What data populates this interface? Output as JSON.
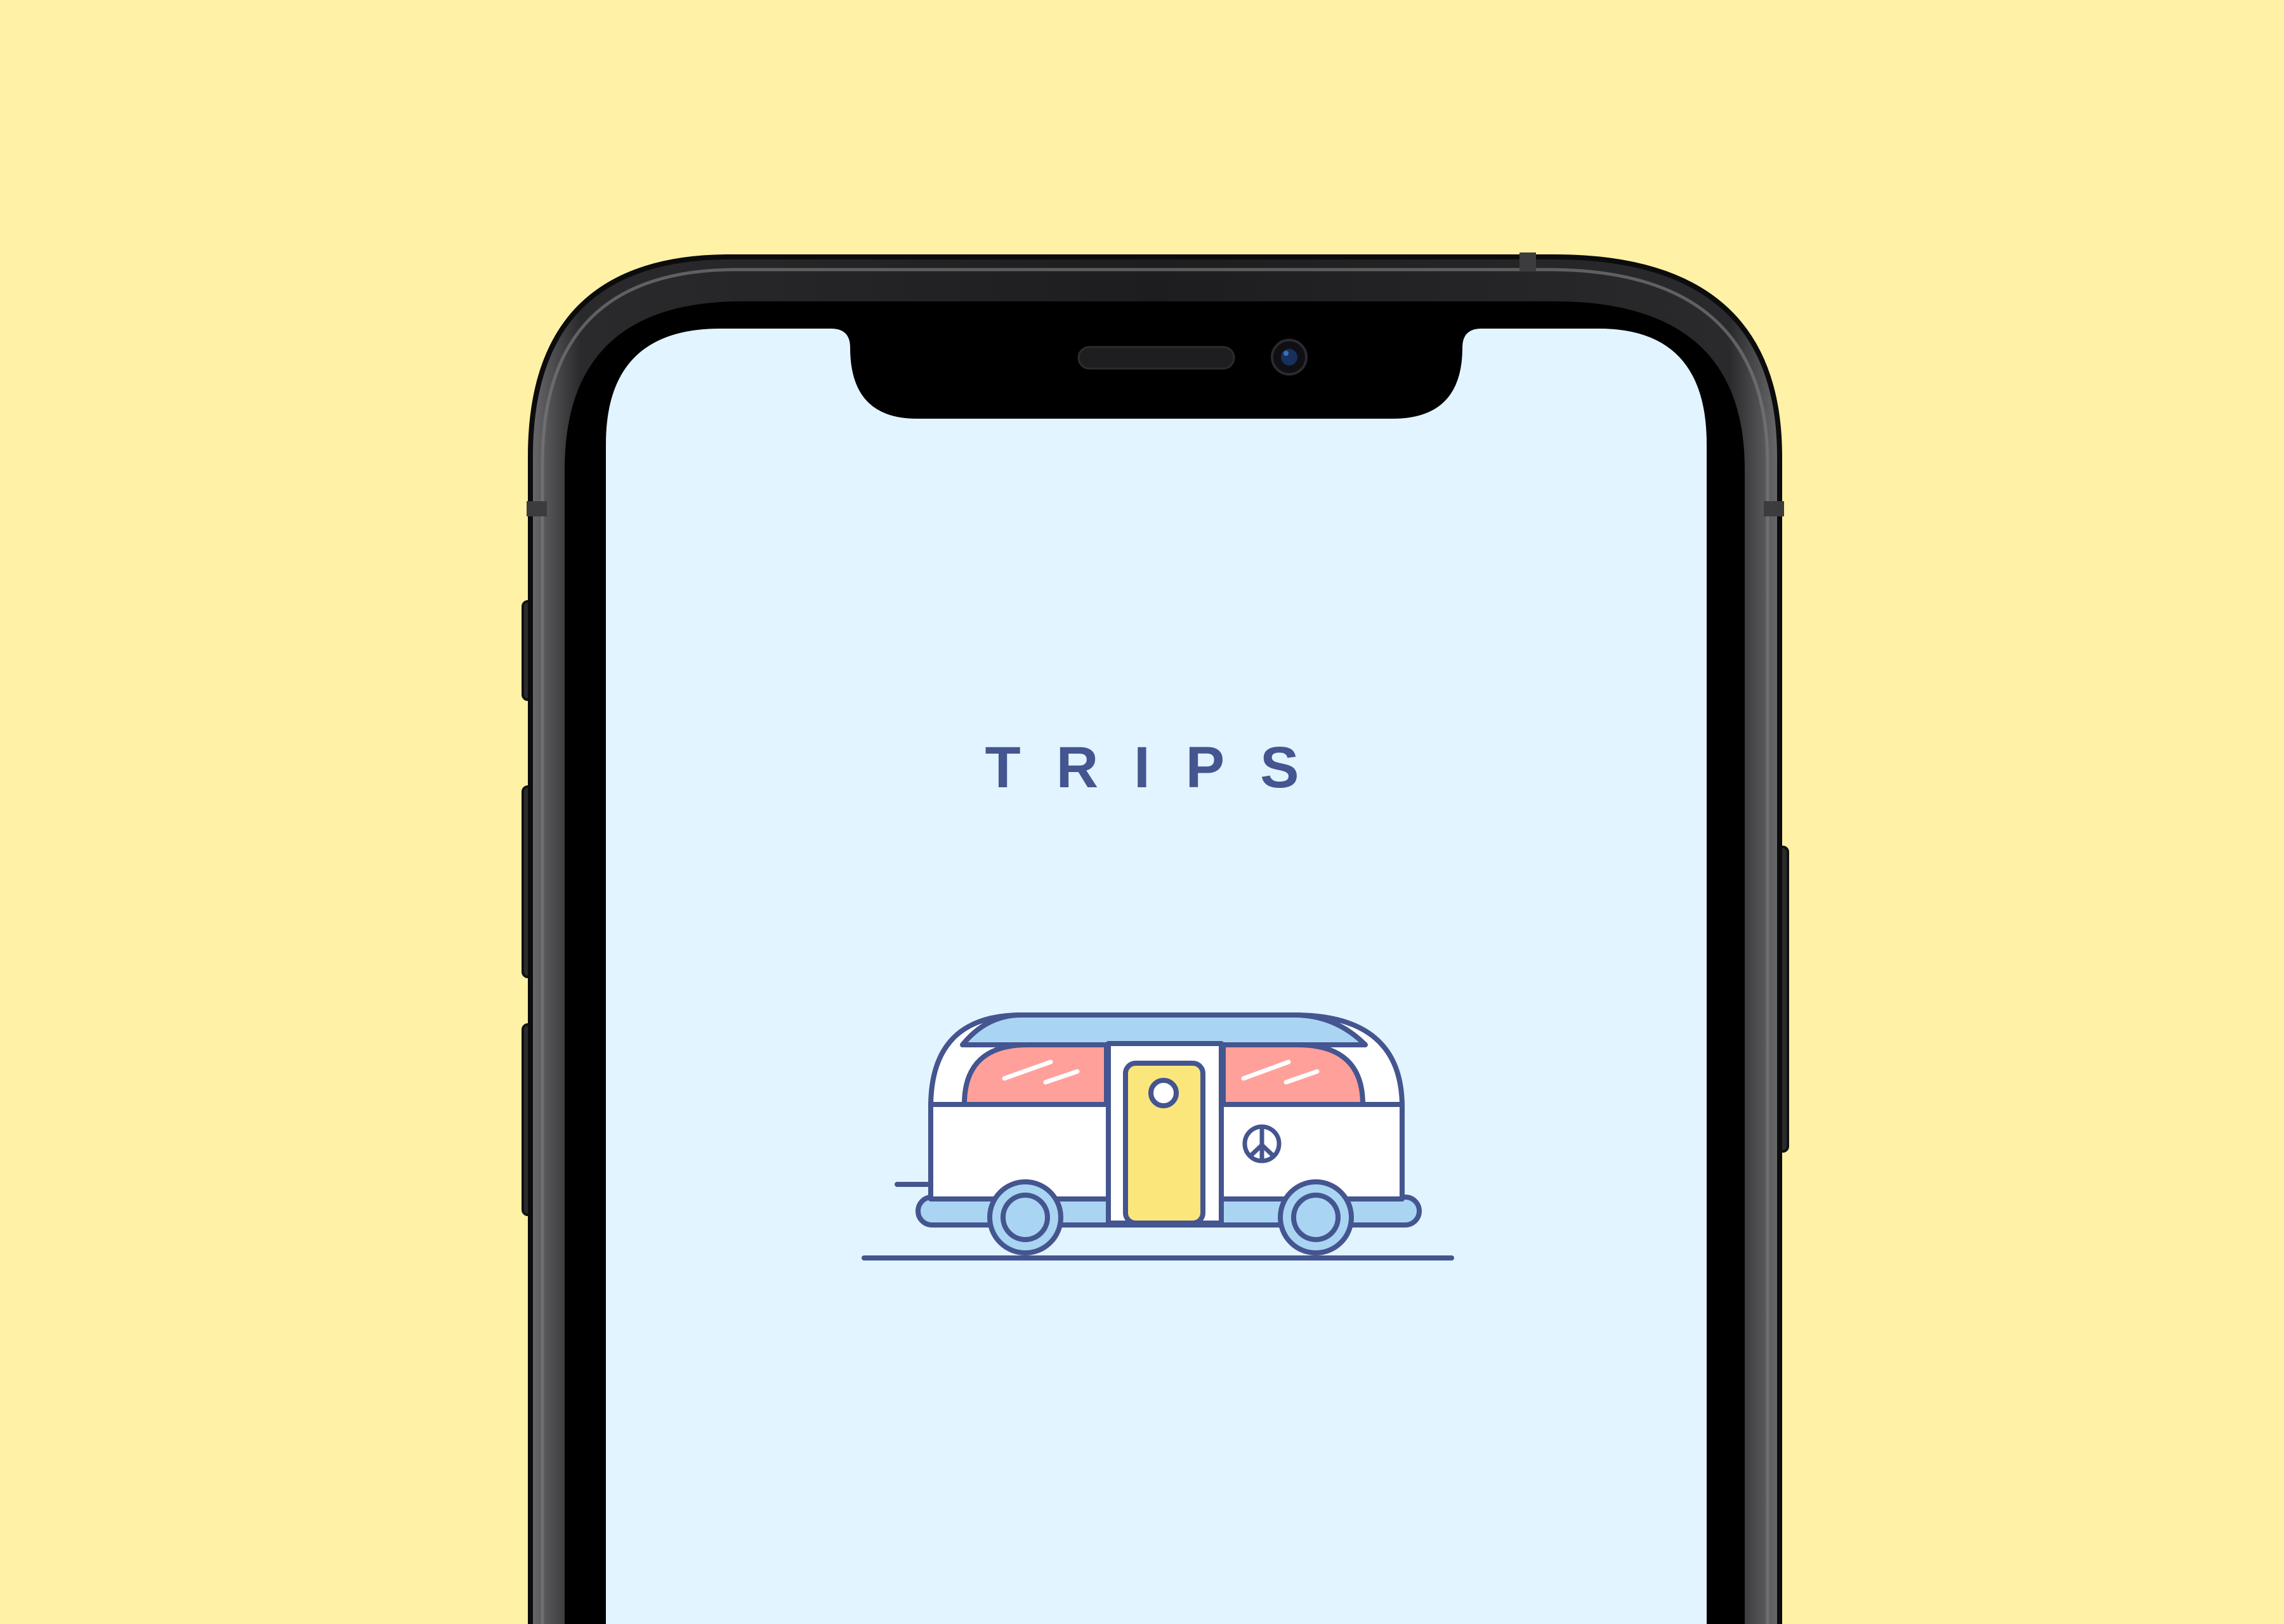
{
  "app": {
    "title": "TRIPS"
  },
  "splash": {
    "illustration": "camper-van-icon",
    "badge": "peace-sign-icon"
  },
  "colors": {
    "background": "#FFF1A5",
    "screen": "#E1F4FF",
    "ink": "#44558F",
    "sky_blue": "#A9D5F2",
    "window_coral": "#FFA09A",
    "door_yellow": "#FBE67C",
    "body_white": "#FFFFFF",
    "phone_frame": "#1B1B1D",
    "phone_bezel": "#000000"
  }
}
